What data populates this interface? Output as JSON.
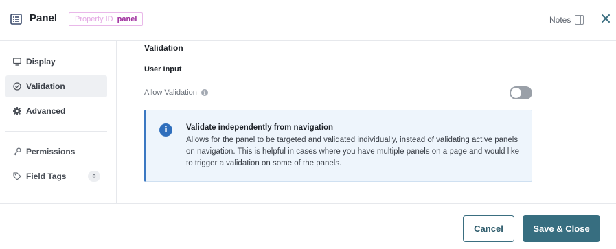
{
  "header": {
    "title": "Panel",
    "property_label": "Property ID",
    "property_value": "panel",
    "notes_label": "Notes"
  },
  "sidebar": {
    "items": [
      {
        "label": "Display",
        "icon": "monitor-icon"
      },
      {
        "label": "Validation",
        "icon": "check-circle-icon",
        "active": true
      },
      {
        "label": "Advanced",
        "icon": "gear-icon"
      },
      {
        "label": "Permissions",
        "icon": "key-icon"
      },
      {
        "label": "Field Tags",
        "icon": "tag-icon",
        "count": "0"
      }
    ]
  },
  "main": {
    "section_title": "Validation",
    "subsection_title": "User Input",
    "allow_validation_label": "Allow Validation",
    "allow_validation_enabled": false,
    "callout": {
      "title": "Validate independently from navigation",
      "body": "Allows for the panel to be targeted and validated individually, instead of validating active panels on navigation. This is helpful in cases where you have multiple panels on a page and would like to trigger a validation on some of the panels."
    }
  },
  "footer": {
    "cancel_label": "Cancel",
    "save_label": "Save & Close"
  },
  "colors": {
    "accent": "#376e80",
    "callout_bg": "#eef5fc",
    "callout_border": "#3b78c2",
    "property_badge": "#a0309f"
  }
}
